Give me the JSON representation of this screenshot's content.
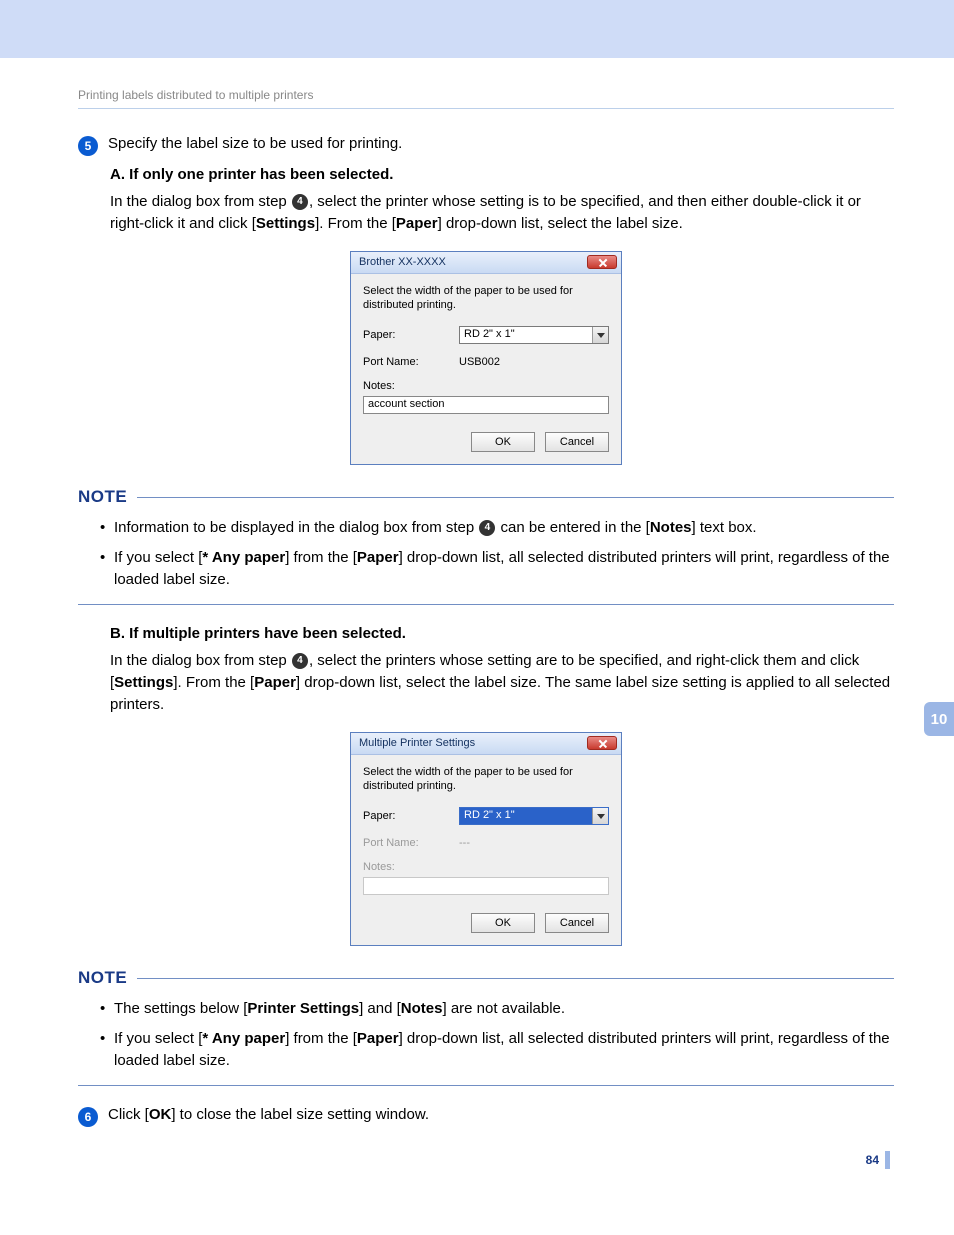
{
  "header": {
    "running": "Printing labels distributed to multiple printers"
  },
  "step5": {
    "num": "5",
    "text": "Specify the label size to be used for printing."
  },
  "sectionA": {
    "heading": "A. If only one printer has been selected.",
    "p1a": "In the dialog box from step ",
    "p1_ref": "4",
    "p1b": ", select the printer whose setting is to be specified, and then either double-click it or right-click it and click [",
    "settings": "Settings",
    "p1c": "]. From the [",
    "paper": "Paper",
    "p1d": "] drop-down list, select the label size."
  },
  "dialog1": {
    "title": "Brother XX-XXXX",
    "instr": "Select the width of the paper to be used for distributed printing.",
    "paper_label": "Paper:",
    "paper_value": "RD 2\" x 1\"",
    "port_label": "Port Name:",
    "port_value": "USB002",
    "notes_label": "Notes:",
    "notes_value": "account section",
    "ok": "OK",
    "cancel": "Cancel"
  },
  "note_label": "NOTE",
  "note1": {
    "b1a": "Information to be displayed in the dialog box from step ",
    "b1_ref": "4",
    "b1b": " can be entered in the [",
    "notes": "Notes",
    "b1c": "] text box.",
    "b2a": "If you select [",
    "any": "* Any paper",
    "b2b": "] from the [",
    "paper": "Paper",
    "b2c": "] drop-down list, all selected distributed printers will print, regardless of the loaded label size."
  },
  "sectionB": {
    "heading": "B. If multiple printers have been selected.",
    "p1a": "In the dialog box from step ",
    "p1_ref": "4",
    "p1b": ", select the printers whose setting are to be specified, and right-click them and click [",
    "settings": "Settings",
    "p1c": "]. From the [",
    "paper": "Paper",
    "p1d": "] drop-down list, select the label size. The same label size setting is applied to all selected printers."
  },
  "dialog2": {
    "title": "Multiple Printer Settings",
    "instr": "Select the width of the paper to be used for distributed printing.",
    "paper_label": "Paper:",
    "paper_value": "RD 2\" x 1\"",
    "port_label": "Port Name:",
    "port_value": "---",
    "notes_label": "Notes:",
    "ok": "OK",
    "cancel": "Cancel"
  },
  "note2": {
    "b1a": "The settings below [",
    "ps": "Printer Settings",
    "b1b": "] and [",
    "notes": "Notes",
    "b1c": "] are not available.",
    "b2a": "If you select [",
    "any": "* Any paper",
    "b2b": "] from the [",
    "paper": "Paper",
    "b2c": "] drop-down list, all selected distributed printers will print, regardless of the loaded label size."
  },
  "step6": {
    "num": "6",
    "a": "Click [",
    "ok": "OK",
    "b": "] to close the label size setting window."
  },
  "side_tab": "10",
  "page_no": "84"
}
